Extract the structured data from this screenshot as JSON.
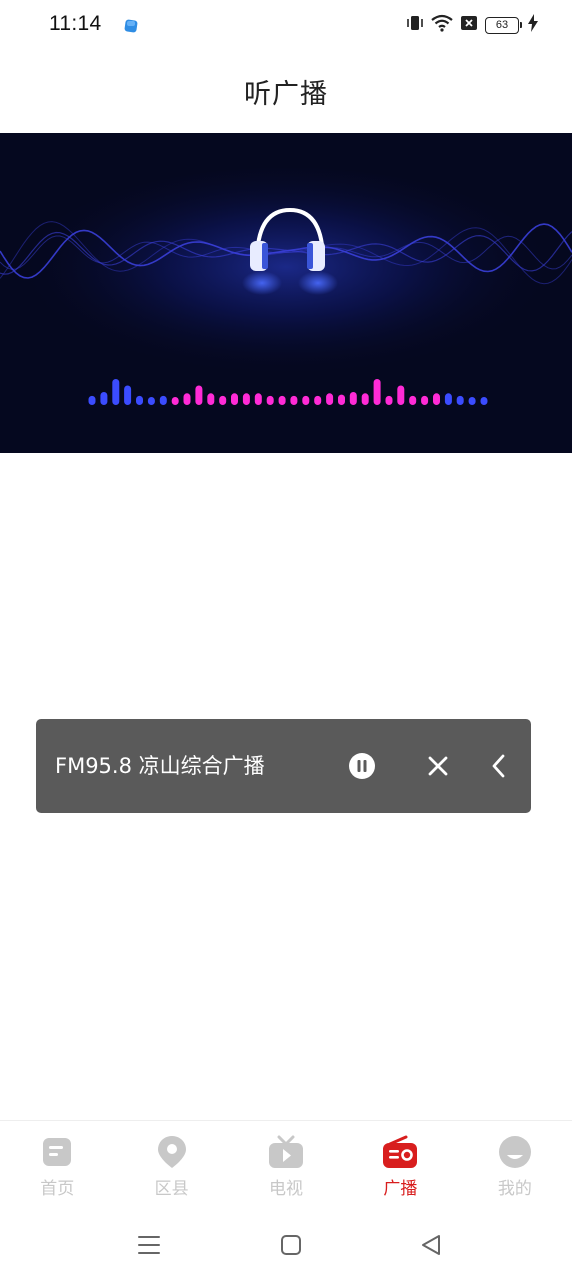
{
  "status_bar": {
    "time": "11:14",
    "battery_level": "63",
    "icons": [
      "app-notification-icon",
      "vibrate-icon",
      "wifi-icon",
      "no-sim-icon",
      "battery-icon",
      "charging-icon"
    ]
  },
  "header": {
    "title": "听广播"
  },
  "banner": {
    "description": "headphones-audio-wave-banner",
    "colors": {
      "background": "#05081f",
      "wave": "#3a3fd8",
      "bar_blue": "#3b4cff",
      "bar_magenta": "#ff2bd6"
    },
    "equalizer_levels": [
      0.35,
      0.5,
      1.0,
      0.75,
      0.35,
      0.25,
      0.35,
      0.3,
      0.45,
      0.75,
      0.45,
      0.35,
      0.45,
      0.45,
      0.45,
      0.35,
      0.35,
      0.35,
      0.35,
      0.35,
      0.45,
      0.4,
      0.5,
      0.45,
      1.0,
      0.35,
      0.75,
      0.35,
      0.35,
      0.45,
      0.45,
      0.35,
      0.3,
      0.3
    ]
  },
  "mini_player": {
    "station": "FM95.8 凉山综合广播",
    "state": "playing",
    "pause_icon": "pause-icon",
    "close_icon": "close-icon",
    "collapse_icon": "chevron-left-icon"
  },
  "bottom_nav": {
    "items": [
      {
        "label": "首页",
        "icon": "home-icon",
        "active": false
      },
      {
        "label": "区县",
        "icon": "location-pin-icon",
        "active": false
      },
      {
        "label": "电视",
        "icon": "tv-icon",
        "active": false
      },
      {
        "label": "广播",
        "icon": "radio-icon",
        "active": true
      },
      {
        "label": "我的",
        "icon": "profile-icon",
        "active": false
      }
    ],
    "active_color": "#d81e1e",
    "inactive_color": "#c8c8c8"
  },
  "system_nav": {
    "buttons": [
      "menu-icon",
      "home-square-icon",
      "back-triangle-icon"
    ]
  }
}
